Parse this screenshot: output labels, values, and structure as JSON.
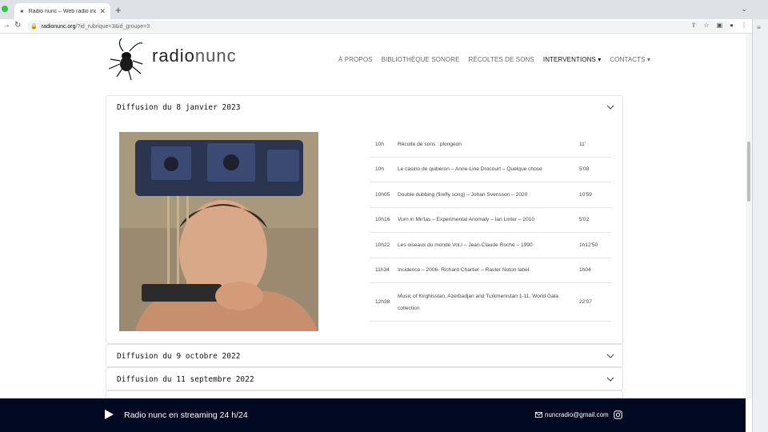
{
  "browser": {
    "tab_title": "Radio nunc – Web radio indépe",
    "url_host": "radionunc.org",
    "url_path": "/?id_rubrique=3&id_groupe=3"
  },
  "site": {
    "brand_radio": "radio",
    "brand_nunc": "nunc",
    "nav": [
      {
        "label": "À PROPOS"
      },
      {
        "label": "BIBLIOTHÈQUE SONORE"
      },
      {
        "label": "RÉCOLTES DE SONS"
      },
      {
        "label": "INTERVENTIONS ▾"
      },
      {
        "label": "CONTACTS ▾"
      }
    ]
  },
  "broadcasts": [
    {
      "title": "Diffusion du 8 janvier 2023"
    },
    {
      "title": "Diffusion du 9 octobre 2022"
    },
    {
      "title": "Diffusion du 11 septembre 2022"
    }
  ],
  "programme": [
    {
      "time": "10h",
      "desc": "Récolte de sons : plongeon",
      "dur": "11'"
    },
    {
      "time": "10h",
      "desc": "Le casino de quiberon – Anne-Line Drocourt – Quelque chose",
      "dur": "5'08"
    },
    {
      "time": "10h05",
      "desc": "Double dubbing (firefly song) – Johan Svensson – 2020",
      "dur": "10'59"
    },
    {
      "time": "10h16",
      "desc": "Vurn in Mir'las – Experimental Anomaly – Ian Linter – 2010",
      "dur": "5'02"
    },
    {
      "time": "10h22",
      "desc": "Les oiseaux du monde Vol.I – Jean-Claude Roché – 1990",
      "dur": "1h12'50"
    },
    {
      "time": "11h34",
      "desc": "Incidence – 2006- Richard Chartier – Raster Noton label",
      "dur": "1h04"
    },
    {
      "time": "12h38",
      "desc": "Music of Kirghisstan, Azerbadjan and Turkmenistan 1-11, World Gala collection",
      "dur": "22'07"
    }
  ],
  "footer": {
    "stream_label": "Radio nunc en streaming 24 h/24",
    "email": "nuncradio@gmail.com"
  }
}
